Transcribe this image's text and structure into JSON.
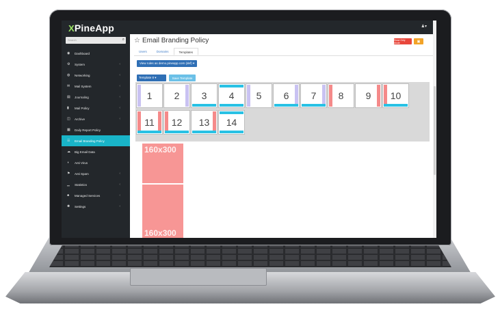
{
  "app": {
    "logo_prefix": "Pine",
    "logo_suffix": "App",
    "logo_mark": "X"
  },
  "search": {
    "placeholder": "Search"
  },
  "sidebar": {
    "items": [
      {
        "label": "Dashboard",
        "icon": "dashboard-icon",
        "glyph": "◉",
        "has_caret": false
      },
      {
        "label": "System",
        "icon": "gears-icon",
        "glyph": "⚙",
        "has_caret": true
      },
      {
        "label": "Networking",
        "icon": "globe-icon",
        "glyph": "◍",
        "has_caret": true
      },
      {
        "label": "Mail System",
        "icon": "envelope-icon",
        "glyph": "✉",
        "has_caret": true
      },
      {
        "label": "Journaling",
        "icon": "journal-icon",
        "glyph": "▤",
        "has_caret": true
      },
      {
        "label": "Mail Policy",
        "icon": "document-icon",
        "glyph": "▮",
        "has_caret": true
      },
      {
        "label": "Archive",
        "icon": "archive-icon",
        "glyph": "◫",
        "has_caret": true
      },
      {
        "label": "Daily Report Policy",
        "icon": "calendar-icon",
        "glyph": "▦",
        "has_caret": false
      },
      {
        "label": "Email Branding Policy",
        "icon": "list-icon",
        "glyph": "☰",
        "has_caret": false
      },
      {
        "label": "Big Email Data",
        "icon": "cloud-icon",
        "glyph": "☁",
        "has_caret": false
      },
      {
        "label": "Anti Virus",
        "icon": "shield-icon",
        "glyph": "◖",
        "has_caret": false
      },
      {
        "label": "Anti Spam",
        "icon": "flag-icon",
        "glyph": "⚑",
        "has_caret": true
      },
      {
        "label": "Statistics",
        "icon": "chart-icon",
        "glyph": "▁",
        "has_caret": true
      },
      {
        "label": "Managed Services",
        "icon": "group-icon",
        "glyph": "♣",
        "has_caret": true
      },
      {
        "label": "Settings",
        "icon": "cog-icon",
        "glyph": "✺",
        "has_caret": true
      }
    ],
    "active_index": 8
  },
  "header": {
    "title": "Email Branding Policy",
    "read_only_label": "Read Only Mode"
  },
  "tabs": [
    {
      "label": "Users"
    },
    {
      "label": "Domains"
    },
    {
      "label": "Templates"
    }
  ],
  "active_tab": 2,
  "view_rules_label": "View rules as demo.pineapp.com (def) ▾",
  "template_dropdown_label": "Template 8 ▾",
  "save_template_label": "Save Template",
  "templates": [
    {
      "label": "1",
      "style": "lav-left"
    },
    {
      "label": "2",
      "style": "lav-right"
    },
    {
      "label": "3",
      "style": "cyan-bottom"
    },
    {
      "label": "4",
      "style": "cyan-topbottom"
    },
    {
      "label": "5",
      "style": "lav-left"
    },
    {
      "label": "6",
      "style": "lav-right-cyan"
    },
    {
      "label": "7",
      "style": "lav-right-cyan"
    },
    {
      "label": "8",
      "style": "pink-left"
    },
    {
      "label": "9",
      "style": "pink-right"
    },
    {
      "label": "10",
      "style": "pink-left-cyan"
    },
    {
      "label": "11",
      "style": "pink-both-cyan"
    },
    {
      "label": "12",
      "style": "pink-left-cyan"
    },
    {
      "label": "13",
      "style": "pink-right-cyan"
    },
    {
      "label": "14",
      "style": "cyan-topbottom"
    }
  ],
  "preview": {
    "label_top": "160x300",
    "label_bottom": "160x300"
  },
  "colors": {
    "accent": "#19b4c8",
    "primary": "#2f6fb5",
    "danger": "#e8463b",
    "warning": "#f2a328",
    "banner_pink": "#f79695"
  }
}
